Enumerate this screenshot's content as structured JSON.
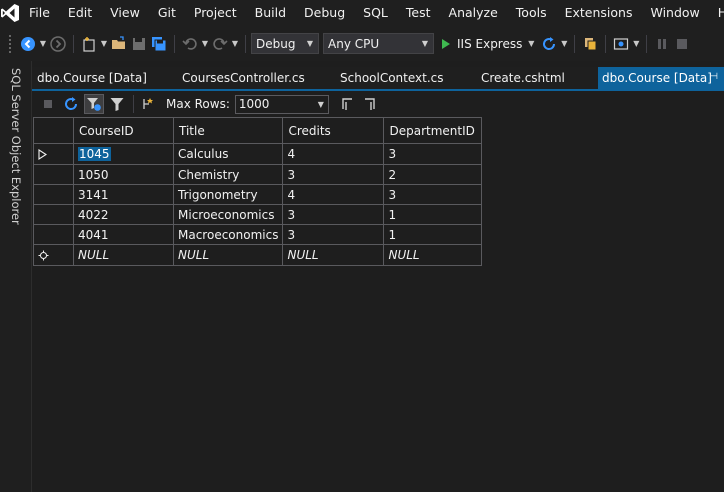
{
  "menu": [
    "File",
    "Edit",
    "View",
    "Git",
    "Project",
    "Build",
    "Debug",
    "SQL",
    "Test",
    "Analyze",
    "Tools",
    "Extensions",
    "Window",
    "Help"
  ],
  "toolbar": {
    "config": "Debug",
    "platform": "Any CPU",
    "run_label": "IIS Express"
  },
  "side_panel": {
    "label": "SQL Server Object Explorer"
  },
  "tabs": [
    {
      "label": "dbo.Course [Data]"
    },
    {
      "label": "CoursesController.cs"
    },
    {
      "label": "SchoolContext.cs"
    },
    {
      "label": "Create.cshtml"
    },
    {
      "label": "dbo.Course [Data]",
      "active": true
    }
  ],
  "data_toolbar": {
    "max_rows_label": "Max Rows:",
    "max_rows_value": "1000"
  },
  "grid": {
    "columns": [
      "CourseID",
      "Title",
      "Credits",
      "DepartmentID"
    ],
    "rows": [
      [
        "1045",
        "Calculus",
        "4",
        "3"
      ],
      [
        "1050",
        "Chemistry",
        "3",
        "2"
      ],
      [
        "3141",
        "Trigonometry",
        "4",
        "3"
      ],
      [
        "4022",
        "Microeconomics",
        "3",
        "1"
      ],
      [
        "4041",
        "Macroeconomics",
        "3",
        "1"
      ]
    ],
    "new_row": [
      "NULL",
      "NULL",
      "NULL",
      "NULL"
    ]
  },
  "colors": {
    "accent": "#0e639c",
    "background": "#1e1e1e",
    "chrome": "#1f1f1f",
    "run_green": "#3fb950"
  }
}
